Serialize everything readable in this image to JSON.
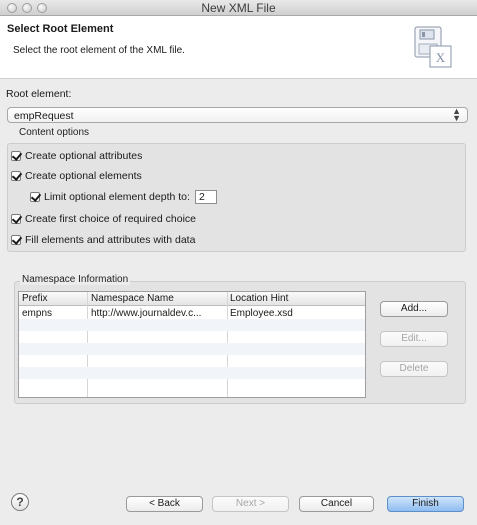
{
  "window": {
    "title": "New XML File"
  },
  "header": {
    "title": "Select Root Element",
    "description": "Select the root element of the XML file."
  },
  "root_element": {
    "label": "Root element:",
    "value": "empRequest"
  },
  "content_options": {
    "legend": "Content options",
    "create_optional_attributes": {
      "label": "Create optional attributes",
      "checked": true
    },
    "create_optional_elements": {
      "label": "Create optional elements",
      "checked": true
    },
    "limit_depth": {
      "label": "Limit optional element depth to:",
      "checked": true,
      "value": "2"
    },
    "create_first_choice": {
      "label": "Create first choice of required choice",
      "checked": true
    },
    "fill_elements": {
      "label": "Fill elements and attributes with data",
      "checked": true
    }
  },
  "namespace": {
    "legend": "Namespace Information",
    "columns": [
      "Prefix",
      "Namespace Name",
      "Location Hint"
    ],
    "rows": [
      {
        "prefix": "empns",
        "name": "http://www.journaldev.c...",
        "hint": "Employee.xsd"
      }
    ],
    "buttons": {
      "add": "Add...",
      "edit": "Edit...",
      "delete": "Delete"
    }
  },
  "footer": {
    "help": "?",
    "back": "< Back",
    "next": "Next >",
    "cancel": "Cancel",
    "finish": "Finish"
  },
  "colors": {
    "accent": "#8fbdf1",
    "window_bg": "#ececec"
  }
}
